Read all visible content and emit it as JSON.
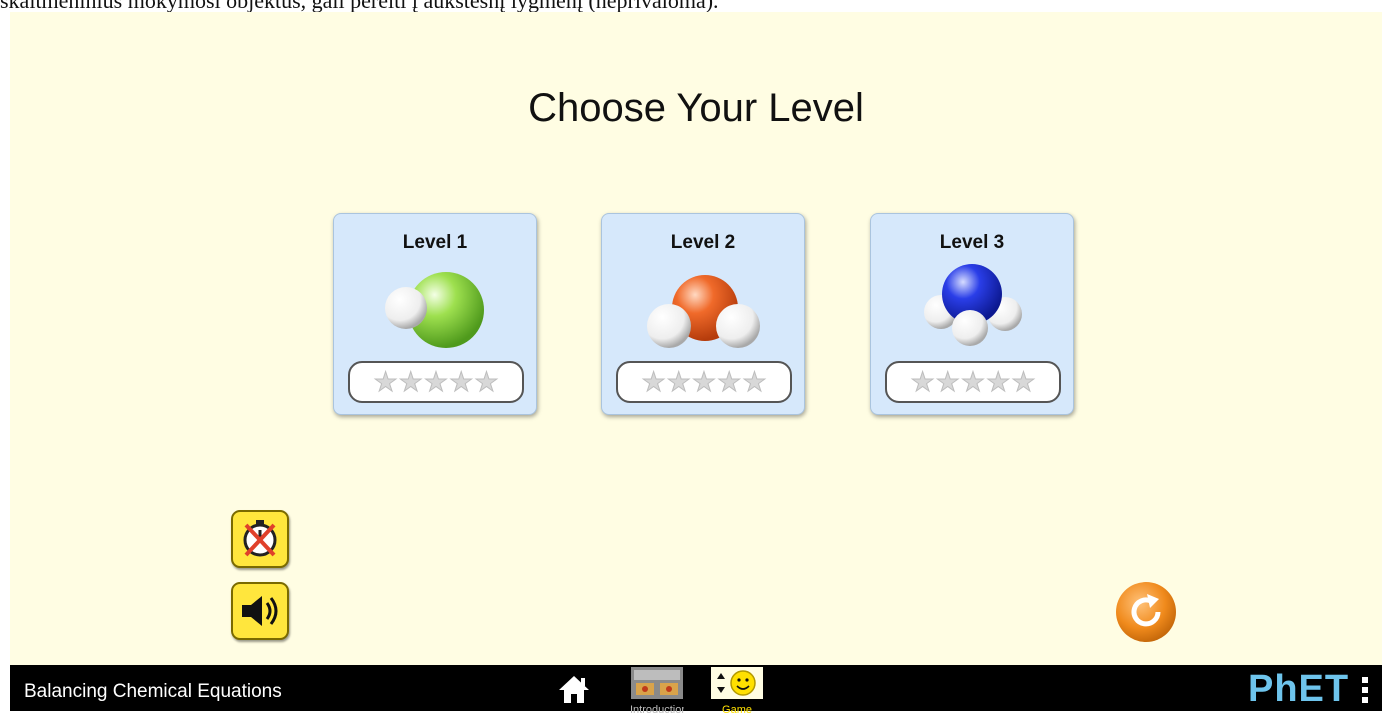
{
  "page": {
    "caption_fragment": "skaitmeninius mokymosi objektus, gali pereiti į aukštesnį lygmenį (neprivaloma)."
  },
  "screen": {
    "title": "Choose Your Level"
  },
  "levels": [
    {
      "label": "Level 1",
      "molecule": "HF-molecule",
      "stars_earned": 0,
      "stars_total": 5
    },
    {
      "label": "Level 2",
      "molecule": "water-molecule",
      "stars_earned": 0,
      "stars_total": 5
    },
    {
      "label": "Level 3",
      "molecule": "ammonia-molecule",
      "stars_earned": 0,
      "stars_total": 5
    }
  ],
  "controls": {
    "timer_toggle": "timer-off-icon",
    "sound_toggle": "sound-on-icon",
    "reset_all": "reset-icon"
  },
  "navbar": {
    "sim_title": "Balancing Chemical Equations",
    "screens": [
      {
        "label": "Introduction",
        "icon": "introduction-thumbnail"
      },
      {
        "label": "Game",
        "icon": "game-thumbnail",
        "selected": true
      }
    ],
    "logo": "PhET"
  },
  "colors": {
    "background": "#fffde3",
    "card": "#d6e8fb",
    "button_yellow": "#ffe63d",
    "reset_orange": "#f08a1c",
    "navbar": "#000000",
    "selected_screen_label": "#ffe000",
    "logo": "#6ec4ec"
  }
}
